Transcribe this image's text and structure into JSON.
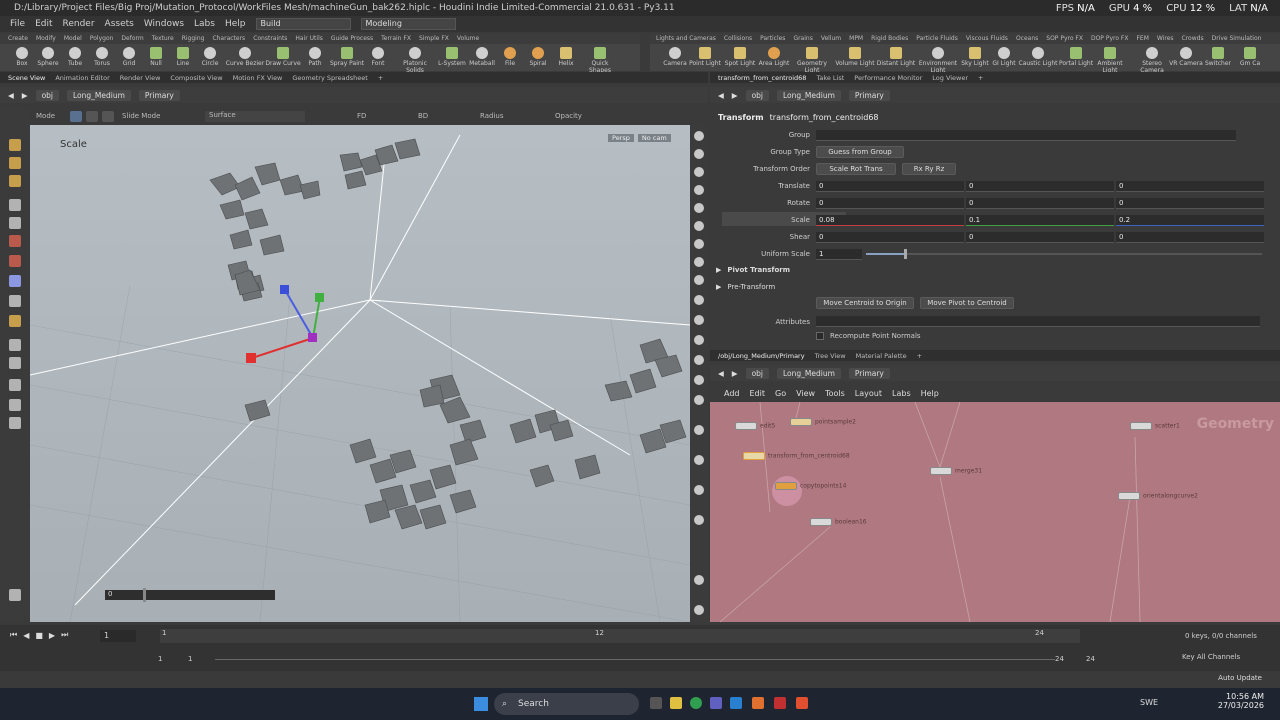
{
  "titlebar": {
    "path": "D:/Library/Project Files/Big Proj/Mutation_Protocol/WorkFiles Mesh/machineGun_bak262.hiplc - Houdini Indie Limited-Commercial 21.0.631 - Py3.11",
    "fps_label": "FPS",
    "fps_value": "N/A",
    "gpu_label": "GPU",
    "gpu_value": "4 %",
    "cpu_label": "CPU",
    "cpu_value": "12 %",
    "lat_label": "LAT",
    "lat_value": "N/A"
  },
  "menubar": {
    "items": [
      "File",
      "Edit",
      "Render",
      "Assets",
      "Windows",
      "Labs",
      "Help"
    ],
    "desktop": "Build",
    "context": "Modeling"
  },
  "shelf": {
    "tabs_left": [
      "Create",
      "Modify",
      "Model",
      "Polygon",
      "Deform",
      "Texture",
      "Rigging",
      "Characters",
      "Constraints",
      "Hair Utils",
      "Guide Process",
      "Terrain FX",
      "Simple FX",
      "Volume"
    ],
    "tools_left": [
      "Box",
      "Sphere",
      "Tube",
      "Torus",
      "Grid",
      "Null",
      "Line",
      "Circle",
      "Curve Bezier",
      "Draw Curve",
      "Path",
      "Spray Paint",
      "Font",
      "Platonic Solids",
      "L-System",
      "Metaball",
      "File",
      "Spiral",
      "Helix",
      "Quick Shapes"
    ],
    "tabs_right": [
      "Lights and Cameras",
      "Collisions",
      "Particles",
      "Grains",
      "Vellum",
      "MPM",
      "Rigid Bodies",
      "Particle Fluids",
      "Viscous Fluids",
      "Oceans",
      "SOP Pyro FX",
      "DOP Pyro FX",
      "FEM",
      "Wires",
      "Crowds",
      "Drive Simulation"
    ],
    "tools_right": [
      "Camera",
      "Point Light",
      "Spot Light",
      "Area Light",
      "Geometry Light",
      "Volume Light",
      "Distant Light",
      "Environment Light",
      "Sky Light",
      "GI Light",
      "Caustic Light",
      "Portal Light",
      "Ambient Light",
      "Stereo Camera",
      "VR Camera",
      "Switcher",
      "Gm Ca"
    ]
  },
  "left_pane": {
    "tabs": [
      "Scene View",
      "Animation Editor",
      "Render View",
      "Composite View",
      "Motion FX View",
      "Geometry Spreadsheet"
    ],
    "path": [
      "obj",
      "Long_Medium",
      "Primary"
    ],
    "toolbar": {
      "mode": "Mode",
      "slide_mode": "Slide Mode",
      "surface": "Surface",
      "fd": "FD",
      "bd": "BD",
      "radius": "Radius",
      "opacity": "Opacity"
    },
    "viewport": {
      "tool_name": "Scale",
      "persp": "Persp",
      "cam": "No cam",
      "slider_value": "0"
    }
  },
  "right_pane": {
    "tabs": [
      "transform_from_centroid68",
      "Take List",
      "Performance Monitor",
      "Log Viewer"
    ],
    "path": [
      "obj",
      "Long_Medium",
      "Primary"
    ],
    "node_type": "Transform",
    "node_name": "transform_from_centroid68",
    "params": {
      "group_label": "Group",
      "group_type_label": "Group Type",
      "group_type": "Guess from Group",
      "transform_order_label": "Transform Order",
      "transform_order": "Scale Rot Trans",
      "rot_order": "Rx Ry Rz",
      "translate_label": "Translate",
      "translate": [
        "0",
        "0",
        "0"
      ],
      "rotate_label": "Rotate",
      "rotate": [
        "0",
        "0",
        "0"
      ],
      "scale_label": "Scale",
      "scale": [
        "0.08",
        "0.1",
        "0.2"
      ],
      "shear_label": "Shear",
      "shear": [
        "0",
        "0",
        "0"
      ],
      "uniform_scale_label": "Uniform Scale",
      "uniform_scale": "1",
      "pivot_transform": "Pivot Transform",
      "pre_transform": "Pre-Transform",
      "btn_centroid_origin": "Move Centroid to Origin",
      "btn_pivot_centroid": "Move Pivot to Centroid",
      "attributes_label": "Attributes",
      "recompute_normals": "Recompute Point Normals"
    }
  },
  "network_pane": {
    "tabs": [
      "/obj/Long_Medium/Primary",
      "Tree View",
      "Material Palette"
    ],
    "path": [
      "obj",
      "Long_Medium",
      "Primary"
    ],
    "menu": [
      "Add",
      "Edit",
      "Go",
      "View",
      "Tools",
      "Layout",
      "Labs",
      "Help"
    ],
    "watermark": "Geometry",
    "nodes": [
      "edit5",
      "pointsample2",
      "transform_from_centroid68",
      "copytopoints14",
      "boolean16",
      "merge31",
      "scatter1",
      "orientalongcurve2"
    ]
  },
  "timeline": {
    "frame": "1",
    "start": "1",
    "start2": "1",
    "end": "24",
    "end2": "24",
    "ticks": [
      "1",
      "12",
      "24"
    ],
    "keys": "0 keys, 0/0 channels",
    "key_all": "Key All Channels",
    "auto_update": "Auto Update"
  },
  "taskbar": {
    "search": "Search",
    "lang": "SWE",
    "time": "10:56 AM",
    "date": "27/03/2026"
  },
  "colors": {
    "network_bg": "#b07880",
    "viewport_bg": "#b2bac0",
    "accent": "#e0a040"
  }
}
